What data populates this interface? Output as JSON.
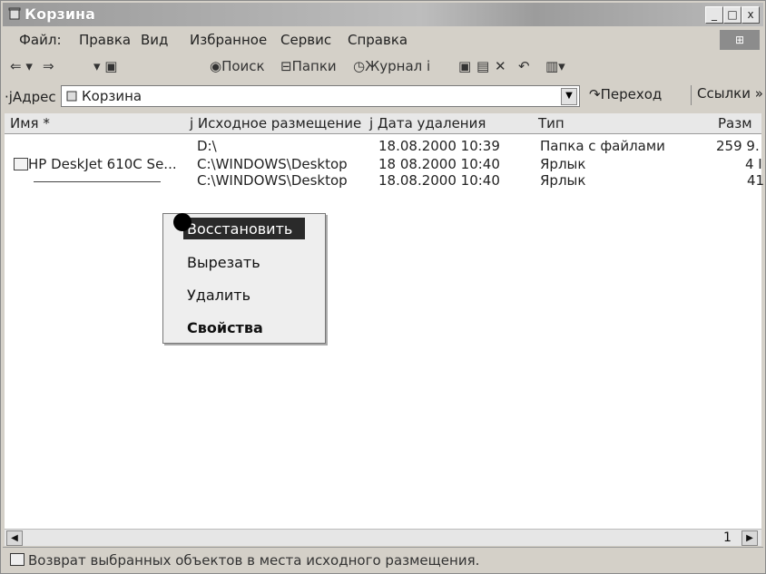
{
  "window": {
    "title": "Корзина",
    "controls": [
      "_",
      "□",
      "x"
    ]
  },
  "menu": [
    "Файл:",
    "Правка",
    "Вид",
    "Избранное",
    "Сервис",
    "Справка"
  ],
  "toolbar": {
    "search": "Поиск",
    "folders": "Папки",
    "history": "Журнал i"
  },
  "address": {
    "label": "·jАдрес",
    "value": "Корзина",
    "go": "Переход",
    "links": "Ссылки »"
  },
  "columns": [
    "Имя *",
    "j Исходное размещение",
    "j Дата удаления",
    "Тип",
    "Разм"
  ],
  "rows": [
    {
      "name": "",
      "origin": "D:\\",
      "date": "18.08.2000 10:39",
      "type": "Папка с файлами",
      "size": "259 9."
    },
    {
      "name": "HP DeskJet 610C Se...",
      "origin": "C:\\WINDOWS\\Desktop",
      "date": "18 08.2000 10:40",
      "type": "Ярлык",
      "size": "4 I"
    },
    {
      "name": "",
      "origin": "C:\\WINDOWS\\Desktop",
      "date": "18.08.2000 10:40",
      "type": "Ярлык",
      "size": "41"
    }
  ],
  "context_menu": [
    "Восстановить",
    "Вырезать",
    "Удалить",
    "Свойства"
  ],
  "scrollbar": {
    "marker": "1"
  },
  "status": "Возврат выбранных объектов в места исходного размещения."
}
